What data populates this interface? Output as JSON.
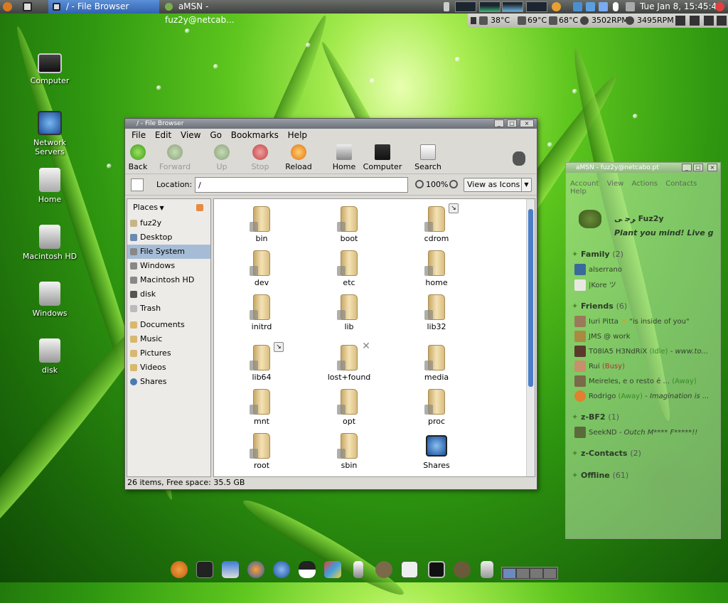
{
  "top_panel": {
    "tasks": [
      "/ - File Browser",
      "aMSN - fuz2y@netcab..."
    ],
    "clock": "Tue Jan  8, 15:45:49"
  },
  "sensors": [
    "38°C",
    "69°C",
    "68°C",
    "3502RPM",
    "3495RPM"
  ],
  "desktop_icons": [
    "Computer",
    "Network Servers",
    "Home",
    "Macintosh HD",
    "Windows",
    "disk"
  ],
  "file_browser": {
    "title": "/ - File Browser",
    "menu": [
      "File",
      "Edit",
      "View",
      "Go",
      "Bookmarks",
      "Help"
    ],
    "toolbar": [
      "Back",
      "Forward",
      "Up",
      "Stop",
      "Reload",
      "Home",
      "Computer",
      "Search"
    ],
    "location_label": "Location:",
    "location_value": "/",
    "zoom": "100%",
    "view_mode": "View as Icons",
    "places_label": "Places",
    "places": [
      "fuz2y",
      "Desktop",
      "File System",
      "Windows",
      "Macintosh HD",
      "disk",
      "Trash",
      "Documents",
      "Music",
      "Pictures",
      "Videos",
      "Shares"
    ],
    "files": [
      "bin",
      "boot",
      "cdrom",
      "dev",
      "etc",
      "home",
      "initrd",
      "lib",
      "lib32",
      "lib64",
      "lost+found",
      "media",
      "mnt",
      "opt",
      "proc",
      "root",
      "sbin",
      "Shares"
    ],
    "status": "26 items, Free space: 35.5 GB"
  },
  "amsn": {
    "title": "aMSN - fuz2y@netcabo.pt",
    "menu": [
      "Account",
      "View",
      "Actions",
      "Contacts",
      "Help"
    ],
    "nick": "ﺮﺟ ﻰ Fuz2y",
    "psm": "Plant you mind! Live g",
    "groups": [
      {
        "name": "Family",
        "count": "(2)"
      },
      {
        "name": "Friends",
        "count": "(6)"
      },
      {
        "name": "z-BF2",
        "count": "(1)"
      },
      {
        "name": "z-Contacts",
        "count": "(2)"
      },
      {
        "name": "Offline",
        "count": "(61)"
      }
    ],
    "family": [
      "alserrano",
      "|Kore ツ"
    ],
    "friends": [
      {
        "name": "Iuri Pitta",
        "extra": "\"is inside of you\""
      },
      {
        "name": "JMS @ work",
        "extra": ""
      },
      {
        "name": "T08lA5 H3NdRiX",
        "status": "(Idle)",
        "extra": "- www.to..."
      },
      {
        "name": "Rui",
        "status": "(Busy)",
        "extra": ""
      },
      {
        "name": "Meireles, e o resto é ...",
        "status": "(Away)",
        "extra": ""
      },
      {
        "name": "Rodrigo",
        "status": "(Away)",
        "extra": "- Imagination is ..."
      }
    ],
    "bf2": {
      "name": "SeekND",
      "extra": "- Outch M**** F*****!!"
    }
  }
}
